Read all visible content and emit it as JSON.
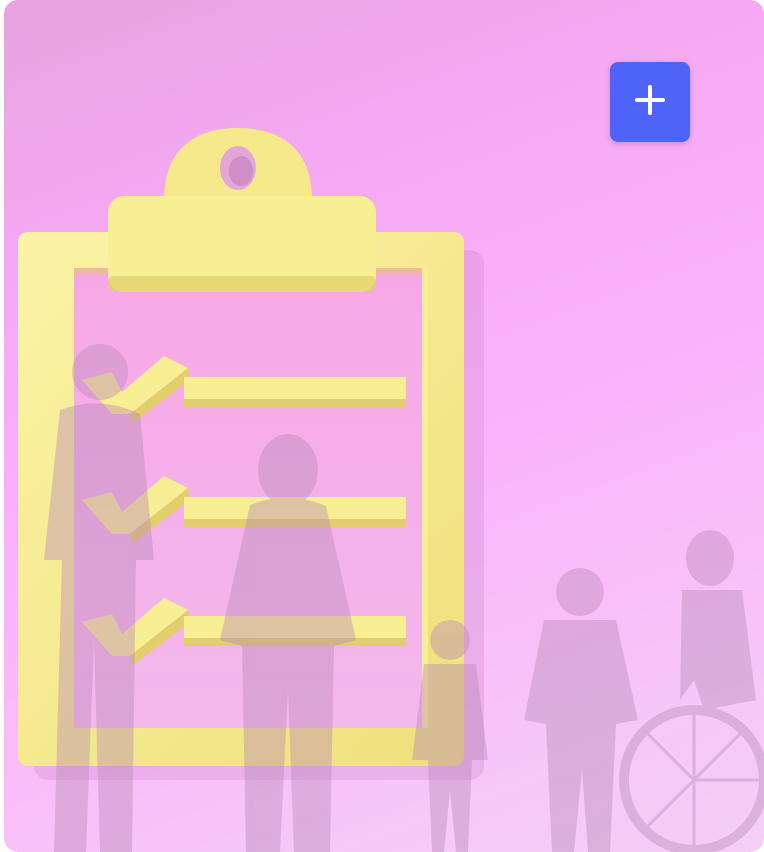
{
  "card": {
    "background_top": "#e9a6e3",
    "background_bottom": "#f4cdf6"
  },
  "clipboard": {
    "color": "#f8ee94",
    "checklist_items": 3
  },
  "add_button": {
    "icon": "plus-icon",
    "background": "#5063f7",
    "icon_color": "#ffffff"
  }
}
